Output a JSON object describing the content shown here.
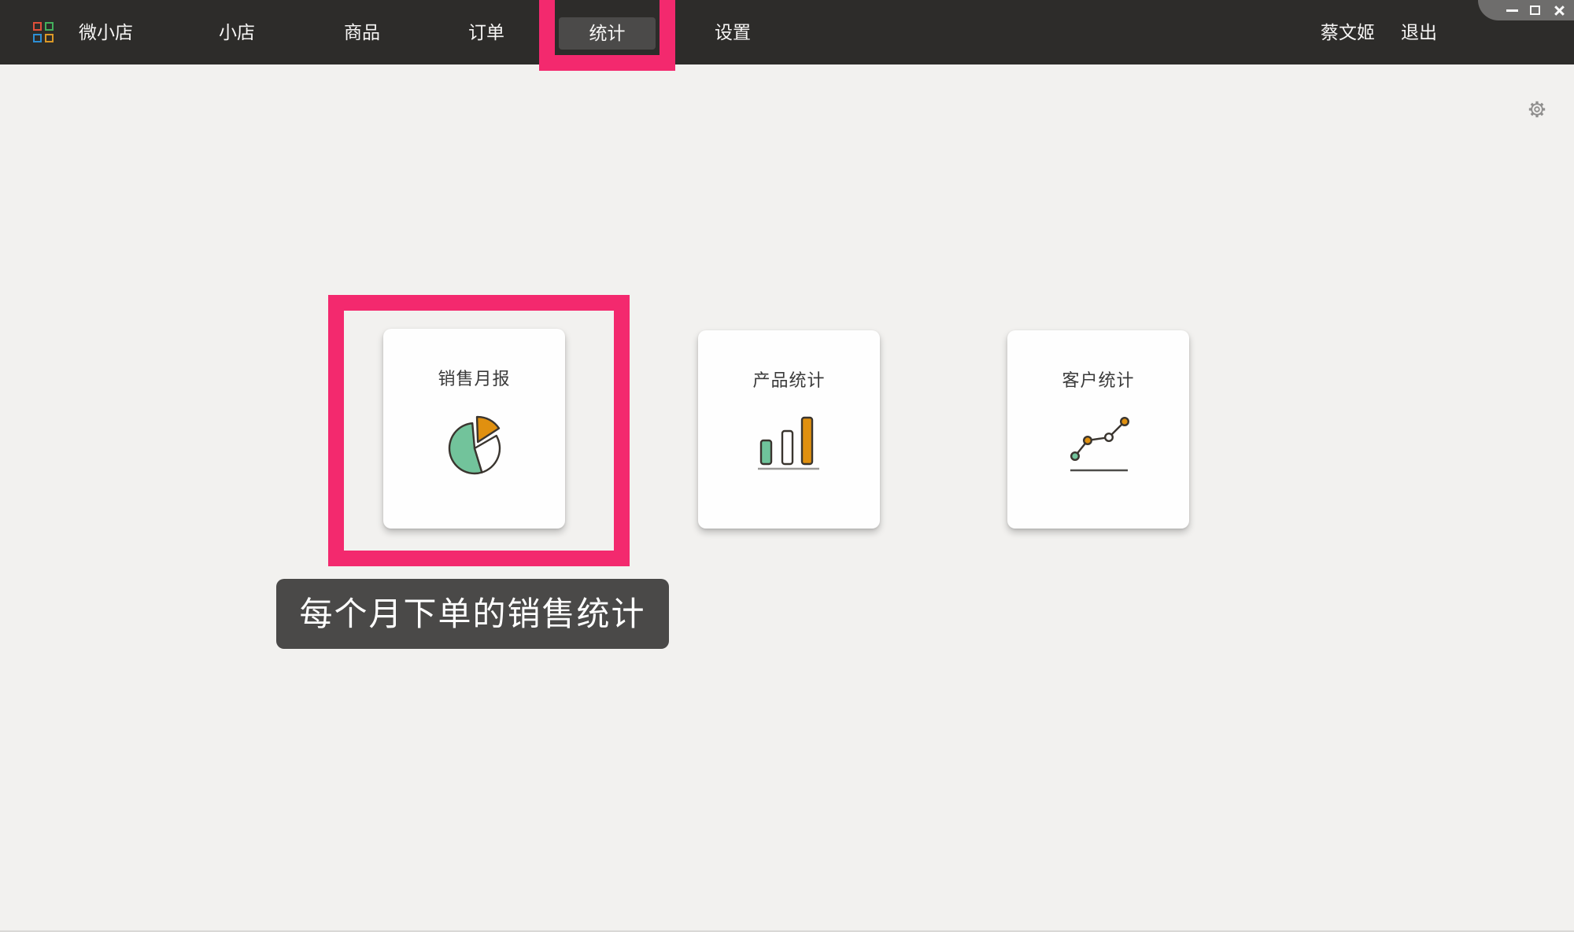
{
  "topbar": {
    "brand": "微小店",
    "menu": [
      {
        "label": "小店",
        "active": false
      },
      {
        "label": "商品",
        "active": false
      },
      {
        "label": "订单",
        "active": false
      },
      {
        "label": "统计",
        "active": true
      },
      {
        "label": "设置",
        "active": false
      }
    ],
    "user_name": "蔡文姬",
    "logout_label": "退出"
  },
  "window_controls": {
    "minimize": "minimize",
    "maximize": "maximize",
    "close": "close"
  },
  "content": {
    "cards": [
      {
        "title": "销售月报",
        "icon": "pie-chart-icon",
        "highlighted": true
      },
      {
        "title": "产品统计",
        "icon": "bar-chart-icon",
        "highlighted": false
      },
      {
        "title": "客户统计",
        "icon": "line-chart-icon",
        "highlighted": false
      }
    ],
    "tooltip": "每个月下单的销售统计"
  },
  "colors": {
    "highlight_pink": "#f3296e",
    "accent_green": "#72c39b",
    "accent_orange": "#e0900f",
    "topbar_bg": "#2d2c2a",
    "active_item_bg": "#4b4a49",
    "tooltip_bg": "#4a4948",
    "page_bg": "#f2f1ef"
  }
}
